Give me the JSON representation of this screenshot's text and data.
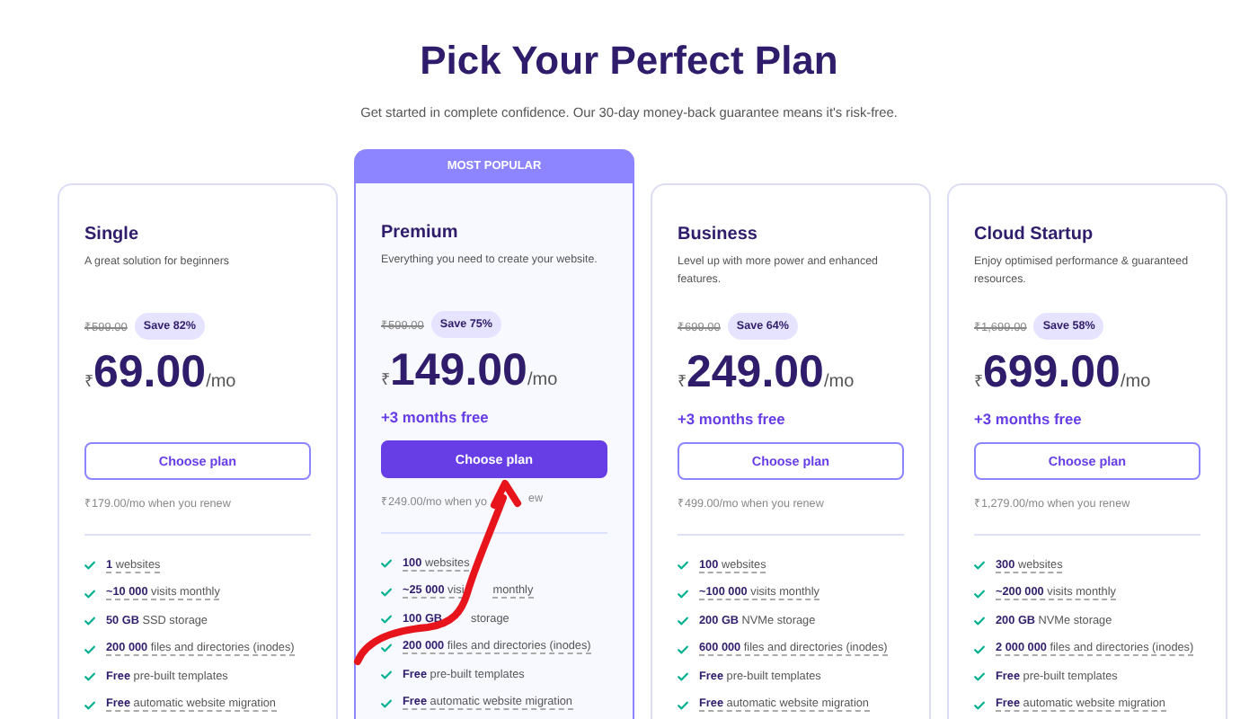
{
  "title": "Pick Your Perfect Plan",
  "subtitle": "Get started in complete confidence. Our 30-day money-back guarantee means it's risk-free.",
  "plans": [
    {
      "name": "Single",
      "popular": false,
      "description": "A great solution for beginners",
      "old_price": "₹599.00",
      "save": "Save 82%",
      "currency": "₹",
      "price": "69.00",
      "period": "/mo",
      "button": "Choose plan",
      "renew": "₹179.00/mo when you renew",
      "features": [
        {
          "text": "**1** websites",
          "underlined": true
        },
        {
          "text": "**~10 000** visits monthly",
          "underlined": true
        },
        {
          "text": "**50 GB** SSD storage",
          "underlined": false
        },
        {
          "text": "**200 000** files and directories (inodes)",
          "underlined": true
        },
        {
          "text": "**Free** pre-built templates",
          "underlined": false
        },
        {
          "text": "**Free** automatic website migration",
          "underlined": true
        }
      ]
    },
    {
      "name": "Premium",
      "popular": true,
      "badge": "MOST POPULAR",
      "description": "Everything you need to create your website.",
      "old_price": "₹599.00",
      "save": "Save 75%",
      "currency": "₹",
      "price": "149.00",
      "period": "/mo",
      "bonus": "+3 months free",
      "button": "Choose plan",
      "renew": "₹249.00/mo when yo",
      "renew_after": "ew",
      "features": [
        {
          "text": "**100** websites",
          "underlined": true
        },
        {
          "text": "**~25 000** visi",
          "text_after": "monthly",
          "underlined": true
        },
        {
          "text": "**100 GB**",
          "text_after": "storage",
          "underlined": false
        },
        {
          "text": "**200 000** files and directories (inodes)",
          "underlined": true
        },
        {
          "text": "**Free** pre-built templates",
          "underlined": false
        },
        {
          "text": "**Free** automatic website migration",
          "underlined": true
        }
      ]
    },
    {
      "name": "Business",
      "popular": false,
      "description": "Level up with more power and enhanced features.",
      "old_price": "₹699.00",
      "save": "Save 64%",
      "currency": "₹",
      "price": "249.00",
      "period": "/mo",
      "bonus": "+3 months free",
      "button": "Choose plan",
      "renew": "₹499.00/mo when you renew",
      "features": [
        {
          "text": "**100** websites",
          "underlined": true
        },
        {
          "text": "**~100 000** visits monthly",
          "underlined": true
        },
        {
          "text": "**200 GB** NVMe storage",
          "underlined": false
        },
        {
          "text": "**600 000** files and directories (inodes)",
          "underlined": true
        },
        {
          "text": "**Free** pre-built templates",
          "underlined": false
        },
        {
          "text": "**Free** automatic website migration",
          "underlined": true
        }
      ]
    },
    {
      "name": "Cloud Startup",
      "popular": false,
      "description": "Enjoy optimised performance & guaranteed resources.",
      "old_price": "₹1,699.00",
      "save": "Save 58%",
      "currency": "₹",
      "price": "699.00",
      "period": "/mo",
      "bonus": "+3 months free",
      "button": "Choose plan",
      "renew": "₹1,279.00/mo when you renew",
      "features": [
        {
          "text": "**300** websites",
          "underlined": true
        },
        {
          "text": "**~200 000** visits monthly",
          "underlined": true
        },
        {
          "text": "**200 GB** NVMe storage",
          "underlined": false
        },
        {
          "text": "**2 000 000** files and directories (inodes)",
          "underlined": true
        },
        {
          "text": "**Free** pre-built templates",
          "underlined": false
        },
        {
          "text": "**Free** automatic website migration",
          "underlined": true
        }
      ]
    }
  ]
}
